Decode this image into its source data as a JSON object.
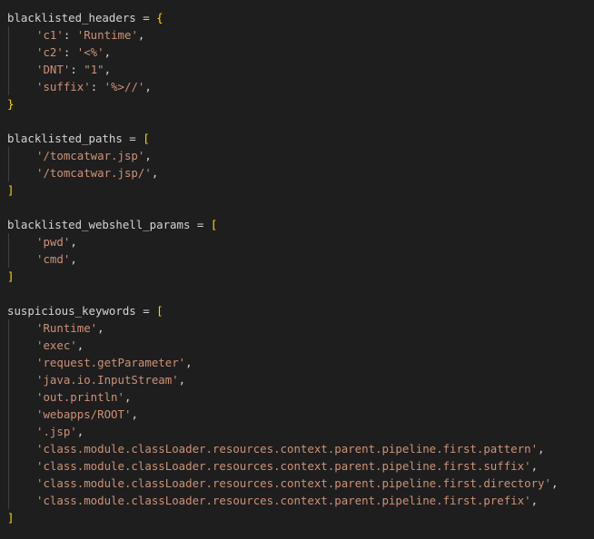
{
  "editor": {
    "theme": {
      "background": "#1e1e1e",
      "text": "#d4d4d4",
      "string": "#ce9178",
      "bracket": "#ffd700"
    },
    "blocks": [
      {
        "name": "blacklisted_headers",
        "assign": " = ",
        "open": "{",
        "close": "}",
        "entries": [
          {
            "key": "'c1'",
            "sep": ": ",
            "value": "'Runtime'",
            "end": ","
          },
          {
            "key": "'c2'",
            "sep": ": ",
            "value": "'<%'",
            "end": ","
          },
          {
            "key": "'DNT'",
            "sep": ": ",
            "value": "\"1\"",
            "end": ","
          },
          {
            "key": "'suffix'",
            "sep": ": ",
            "value": "'%>//'",
            "end": ","
          }
        ]
      },
      {
        "name": "blacklisted_paths",
        "assign": " = ",
        "open": "[",
        "close": "]",
        "items": [
          {
            "value": "'/tomcatwar.jsp'",
            "end": ","
          },
          {
            "value": "'/tomcatwar.jsp/'",
            "end": ","
          }
        ]
      },
      {
        "name": "blacklisted_webshell_params",
        "assign": " = ",
        "open": "[",
        "close": "]",
        "items": [
          {
            "value": "'pwd'",
            "end": ","
          },
          {
            "value": "'cmd'",
            "end": ","
          }
        ]
      },
      {
        "name": "suspicious_keywords",
        "assign": " = ",
        "open": "[",
        "close": "]",
        "items": [
          {
            "value": "'Runtime'",
            "end": ","
          },
          {
            "value": "'exec'",
            "end": ","
          },
          {
            "value": "'request.getParameter'",
            "end": ","
          },
          {
            "value": "'java.io.InputStream'",
            "end": ","
          },
          {
            "value": "'out.println'",
            "end": ","
          },
          {
            "value": "'webapps/ROOT'",
            "end": ","
          },
          {
            "value": "'.jsp'",
            "end": ","
          },
          {
            "value": "'class.module.classLoader.resources.context.parent.pipeline.first.pattern'",
            "end": ","
          },
          {
            "value": "'class.module.classLoader.resources.context.parent.pipeline.first.suffix'",
            "end": ","
          },
          {
            "value": "'class.module.classLoader.resources.context.parent.pipeline.first.directory'",
            "end": ","
          },
          {
            "value": "'class.module.classLoader.resources.context.parent.pipeline.first.prefix'",
            "end": ","
          }
        ]
      }
    ]
  }
}
